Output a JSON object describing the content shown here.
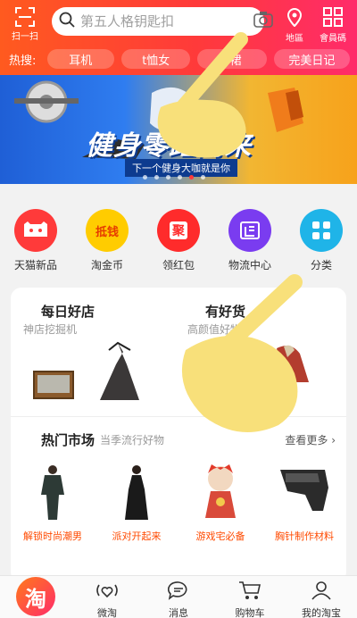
{
  "header": {
    "scan_label": "扫一扫",
    "search_placeholder": "第五人格钥匙扣",
    "map_label": "地區",
    "code_label": "會員碼"
  },
  "hot_search": {
    "label": "热搜:",
    "chips": [
      "耳机",
      "t恤女",
      "a裙",
      "完美日记"
    ]
  },
  "banner": {
    "title": "健身零距离来",
    "subtitle": "下一个健身大咖就是你",
    "dots": 6,
    "active_dot": 4
  },
  "categories": [
    {
      "label": "天猫新品",
      "color": "#ff3a3a",
      "icon": "tmall-cat-icon"
    },
    {
      "label": "淘金币",
      "color": "#ffcc00",
      "icon": "coin-icon",
      "glyph": "抵钱"
    },
    {
      "label": "领红包",
      "color": "#ff2b2b",
      "icon": "red-packet-icon",
      "glyph": "聚"
    },
    {
      "label": "物流中心",
      "color": "#7a3cf0",
      "icon": "logistics-icon"
    },
    {
      "label": "分类",
      "color": "#1fb4e8",
      "icon": "grid-icon"
    }
  ],
  "card": {
    "left_title": "每日好店",
    "left_sub": "神店挖掘机",
    "right_title": "有好货",
    "right_sub": "高颜值好物",
    "market_title": "热门市场",
    "market_sub": "当季流行好物",
    "more_label": "查看更多 ›",
    "market_items": [
      "解锁时尚潮男",
      "派对开起来",
      "游戏宅必备",
      "胸针制作材料"
    ]
  },
  "nav": {
    "items": [
      "微淘",
      "消息",
      "购物车",
      "我的淘宝"
    ],
    "home_glyph": "淘"
  }
}
